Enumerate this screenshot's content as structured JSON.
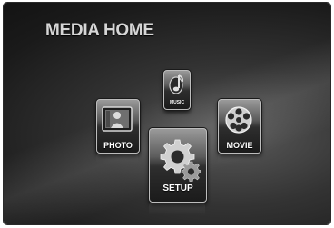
{
  "screen": {
    "title": "MEDIA HOME"
  },
  "menu": {
    "music": {
      "label": "MUSIC",
      "icon": "music-note-icon"
    },
    "photo": {
      "label": "PHOTO",
      "icon": "photo-icon"
    },
    "movie": {
      "label": "MOVIE",
      "icon": "film-reel-icon"
    },
    "setup": {
      "label": "SETUP",
      "icon": "gear-icon"
    }
  }
}
